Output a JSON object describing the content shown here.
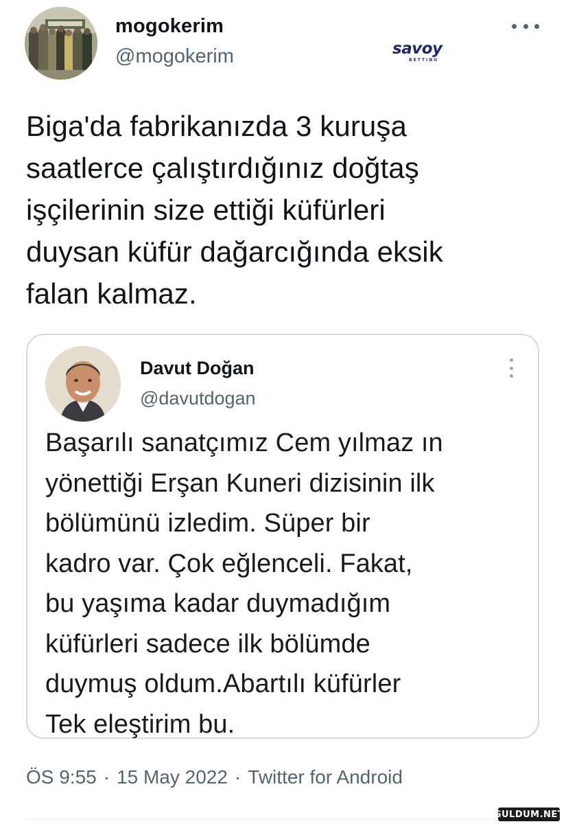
{
  "author": {
    "display_name": "mogokerim",
    "handle": "@mogokerim"
  },
  "brand_logo": {
    "word": "savoy",
    "sub": "BETTING"
  },
  "tweet_text_lines": [
    "Biga'da fabrikanızda 3 kuruşa",
    "saatlerce çalıştırdığınız doğtaş",
    "işçilerinin size ettiği küfürleri",
    "duysan küfür dağarcığında eksik",
    "falan kalmaz."
  ],
  "quoted": {
    "display_name": "Davut Doğan",
    "handle": "@davutdogan",
    "text_lines": [
      "Başarılı sanatçımız Cem yılmaz ın",
      "yönettiği Erşan Kuneri dizisinin ilk",
      "bölümünü izledim. Süper bir",
      "kadro var. Çok eğlenceli. Fakat,",
      "bu yaşıma kadar duymadığım",
      "küfürleri sadece ilk bölümde",
      "duymuş oldum.Abartılı küfürler",
      "Tek eleştirim bu."
    ]
  },
  "meta": {
    "time": "ÖS 9:55",
    "date": "15 May 2022",
    "source": "Twitter for Android",
    "separator": "·"
  },
  "watermark": "GULDUM.NET",
  "icons": {
    "more": "more-horizontal-icon",
    "quote_more": "more-vertical-icon"
  },
  "colors": {
    "text": "#0f1419",
    "secondary": "#536471",
    "border": "#cfd9de",
    "brand": "#1f2a63"
  }
}
